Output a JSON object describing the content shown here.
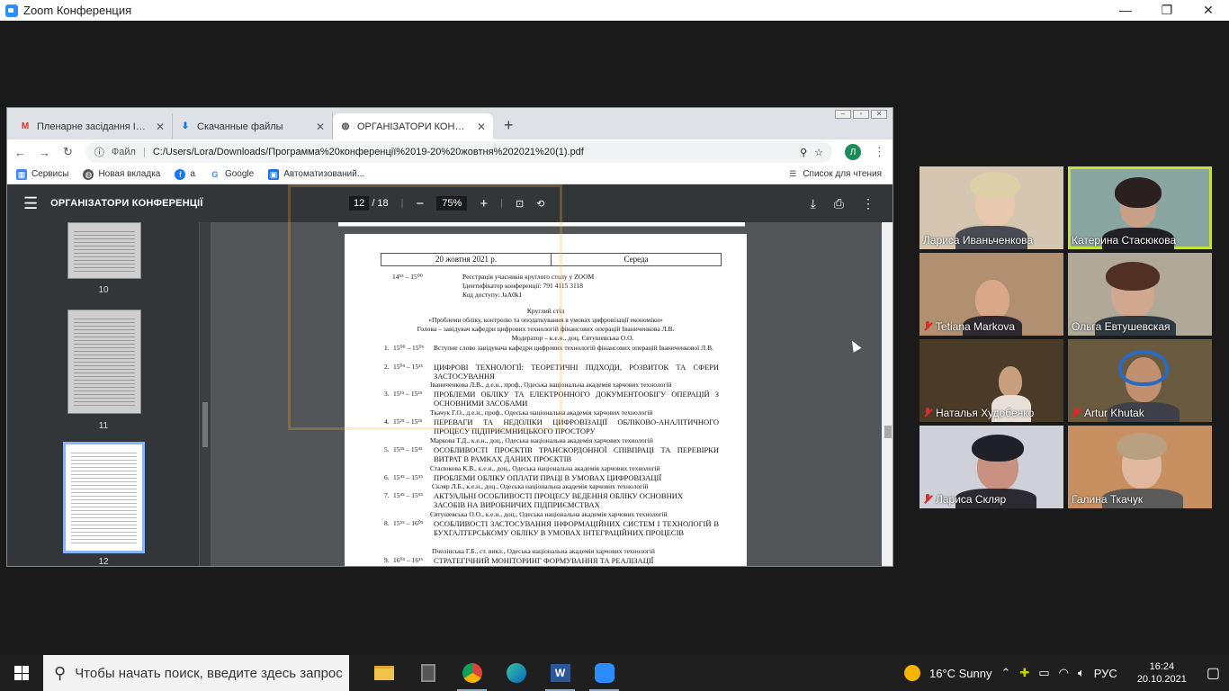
{
  "zoom_window": {
    "title": "Zoom Конференция",
    "controls": [
      "—",
      "❐",
      "✕"
    ]
  },
  "browser": {
    "tabs": [
      {
        "label": "Пленарне засідання IX Міжнарод",
        "icon": "gmail-icon"
      },
      {
        "label": "Скачанные файлы",
        "icon": "download-icon"
      },
      {
        "label": "ОРГАНІЗАТОРИ КОНФЕРЕНЦІЇ",
        "icon": "globe-icon"
      }
    ],
    "new_tab": "+",
    "address": {
      "file_label": "Файл",
      "url": "C:/Users/Lora/Downloads/Программа%20конференції%2019-20%20жовтня%202021%20(1).pdf"
    },
    "avatar_letter": "Л",
    "bookmarks": [
      {
        "label": "Сервисы",
        "icon": "apps-icon"
      },
      {
        "label": "Новая вкладка",
        "icon": "globe-icon"
      },
      {
        "label": "а",
        "icon": "facebook-icon"
      },
      {
        "label": "Google",
        "icon": "google-icon"
      },
      {
        "label": "Автоматизований...",
        "icon": "bookmark-icon"
      }
    ],
    "reading_list": "Список для чтения"
  },
  "pdf_viewer": {
    "title": "ОРГАНІЗАТОРИ КОНФЕРЕНЦІЇ",
    "page_current": "12",
    "page_total": "/ 18",
    "zoom": "75%",
    "thumbnails": [
      {
        "label": "10"
      },
      {
        "label": "11"
      },
      {
        "label": "12"
      }
    ],
    "document": {
      "date": "20 жовтня 2021 р.",
      "day": "Середа",
      "reg_time": "14⁵⁵ – 15⁰⁰",
      "reg_lines": [
        "Реєстрація учасників круглого столу у ZOOM",
        "Ідентифікатор конференції: 791 4115 3118",
        "Код доступу: JaA0k1"
      ],
      "heading": [
        "Круглий стіл",
        "«Проблеми обліку, контролю та оподаткування в умовах цифровізації економіки»",
        "Голова – завідувач кафедри цифрових технологій фінансових операцій Іваниченкова Л.В.",
        "Модератор – к.е.н., доц. Євтушевська О.О."
      ],
      "items": [
        {
          "n": "1.",
          "time": "15⁰⁰ – 15⁰⁵",
          "title": "Вступне слово завідувача кафедри цифрових технологій фінансових операцій Іваниченкової Л.В.",
          "author": ""
        },
        {
          "n": "2.",
          "time": "15⁰⁵ – 15¹⁵",
          "title": "ЦИФРОВІ ТЕХНОЛОГІЇ: ТЕОРЕТИЧНІ ПІДХОДИ, РОЗВИТОК ТА СФЕРИ ЗАСТОСУВАННЯ",
          "author": "Іваниченкова Л.В., д.е.н., проф., Одеська національна академія харчових технологій"
        },
        {
          "n": "3.",
          "time": "15¹⁵ – 15²⁵",
          "title": "ПРОБЛЕМИ ОБЛІКУ ТА ЕЛЕКТРОННОГО ДОКУМЕНТООБІГУ ОПЕРАЦІЙ З ОСНОВНИМИ ЗАСОБАМИ",
          "author": "Ткачук Г.О., д.е.н., проф., Одеська національна академія харчових технологій"
        },
        {
          "n": "4.",
          "time": "15²⁵ – 15³⁵",
          "title": "ПЕРЕВАГИ ТА НЕДОЛІКИ ЦИФРОВІЗАЦІЇ ОБЛІКОВО-АНАЛІТИЧНОГО ПРОЦЕСУ ПІДПРИЄМНИЦЬКОГО ПРОСТОРУ",
          "author": "Маркова Т.Д., к.е.н., доц., Одеська національна академія харчових технологій"
        },
        {
          "n": "5.",
          "time": "15³⁵ – 15⁴⁵",
          "title": "ОСОБЛИВОСТІ ПРОЄКТІВ ТРАНСКОРДОННОЇ СПІВПРАЦІ ТА ПЕРЕВІРКИ ВИТРАТ В РАМКАХ ДАНИХ ПРОЄКТІВ",
          "author": "Стасюкова К.В., к.е.н., доц., Одеська національна академія харчових технологій"
        },
        {
          "n": "6.",
          "time": "15⁴⁵ – 15⁵⁵",
          "title": "ПРОБЛЕМИ ОБЛІКУ ОПЛАТИ ПРАЦІ В УМОВАХ ЦИФРОВІЗАЦІЇ",
          "author": "Скляр Л.Б., к.е.н., доц., Одеська національна академія харчових технологій"
        },
        {
          "n": "7.",
          "time": "15⁴⁵ – 15⁵⁵",
          "title": "АКТУАЛЬНІ ОСОБЛИВОСТІ ПРОЦЕСУ ВЕДЕННЯ ОБЛІКУ ОСНОВНИХ ЗАСОБІВ НА ВИРОБНИЧИХ ПІДПРИЄМСТВАХ",
          "author": "Євтушевська О.О., к.е.н., доц., Одеська національна академія харчових технологій"
        },
        {
          "n": "8.",
          "time": "15⁵⁵ – 16⁰⁵",
          "title": "ОСОБЛИВОСТІ ЗАСТОСУВАННЯ ІНФОРМАЦІЙНИХ СИСТЕМ І ТЕХНОЛОГІЙ В БУХГАЛТЕРСЬКОМУ ОБЛІКУ В УМОВАХ ІНТЕГРАЦІЙНИХ ПРОЦЕСІВ",
          "author": "Пчелінська Г.Б., ст. викл., Одеська національна академія харчових технологій"
        },
        {
          "n": "9.",
          "time": "16⁰⁵ – 16¹⁵",
          "title": "СТРАТЕГІЧНИЙ МОНІТОРИНГ ФОРМУВАННЯ ТА РЕАЛІЗАЦІЇ",
          "author": ""
        }
      ]
    }
  },
  "participants": [
    {
      "name": "Лариса Иваньченкова",
      "muted": false,
      "active": false,
      "bg": "#c9b8a0"
    },
    {
      "name": "Катерина Стасюкова",
      "muted": false,
      "active": true,
      "bg": "#8aa6a0"
    },
    {
      "name": "Tetiana Markova",
      "muted": true,
      "active": false,
      "bg": "#b09070"
    },
    {
      "name": "Ольга Евтушевская",
      "muted": false,
      "active": false,
      "bg": "#b0a898"
    },
    {
      "name": "Наталья Худобенко",
      "muted": true,
      "active": false,
      "bg": "#5a4a35"
    },
    {
      "name": "Artur Khutak",
      "muted": true,
      "active": false,
      "bg": "#7a6a50"
    },
    {
      "name": "Лариса Скляр",
      "muted": true,
      "active": false,
      "bg": "#c8c8d0"
    },
    {
      "name": "Галина Ткачук",
      "muted": false,
      "active": false,
      "bg": "#c89060"
    }
  ],
  "taskbar": {
    "search_placeholder": "Чтобы начать поиск, введите здесь запрос",
    "apps": [
      "file-explorer-icon",
      "calculator-icon",
      "chrome-icon",
      "edge-icon",
      "word-icon",
      "zoom-icon"
    ],
    "weather": "16°C  Sunny",
    "language": "РУС",
    "time": "16:24",
    "date": "20.10.2021"
  }
}
